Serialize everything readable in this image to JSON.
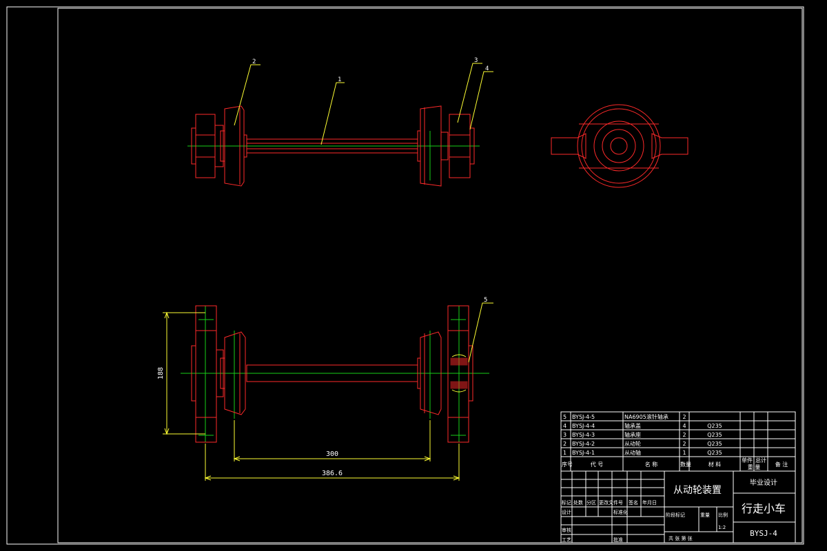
{
  "colors": {
    "background": "#000000",
    "frame": "#ffffff",
    "part_outline": "#ff2a2a",
    "centerline": "#19d019",
    "dimension": "#ffff33",
    "leader": "#ffff33",
    "text": "#ffffff"
  },
  "balloons": [
    "1",
    "2",
    "3",
    "4",
    "5"
  ],
  "dimensions": {
    "height": "188",
    "span_inner": "300",
    "span_outer": "386.6"
  },
  "parts_list": {
    "rows": [
      {
        "no": "5",
        "code": "BYSJ-4-5",
        "name": "NA6905滚针轴承",
        "qty": "2",
        "material": ""
      },
      {
        "no": "4",
        "code": "BYSJ-4-4",
        "name": "轴承盖",
        "qty": "4",
        "material": "Q235"
      },
      {
        "no": "3",
        "code": "BYSJ-4-3",
        "name": "轴承座",
        "qty": "2",
        "material": "Q235"
      },
      {
        "no": "2",
        "code": "BYSJ-4-2",
        "name": "从动轮",
        "qty": "2",
        "material": "Q235"
      },
      {
        "no": "1",
        "code": "BYSJ-4-1",
        "name": "从动轴",
        "qty": "1",
        "material": "Q235"
      }
    ],
    "headers": {
      "no": "序号",
      "code": "代 号",
      "name": "名 称",
      "qty": "数量",
      "material": "材 料",
      "unit_weight": "单件",
      "total_weight": "总计",
      "weight": "重 量",
      "remarks": "备 注"
    }
  },
  "title_block": {
    "drawing_name": "从动轮装置",
    "project_type": "毕业设计",
    "project_name": "行走小车",
    "drawing_no": "BYSJ-4",
    "labels": {
      "mark": "标记",
      "count": "处数",
      "zone": "分区",
      "change_doc": "更改文件号",
      "sign": "签名",
      "date": "年月日",
      "design": "设计",
      "standardize": "标准化",
      "check": "审核",
      "process": "工艺",
      "approve": "批准",
      "stage_mark": "阶段标记",
      "weight": "重量",
      "scale": "比例",
      "sheets": "共 张 第 张",
      "scale_value": "1:2"
    }
  }
}
